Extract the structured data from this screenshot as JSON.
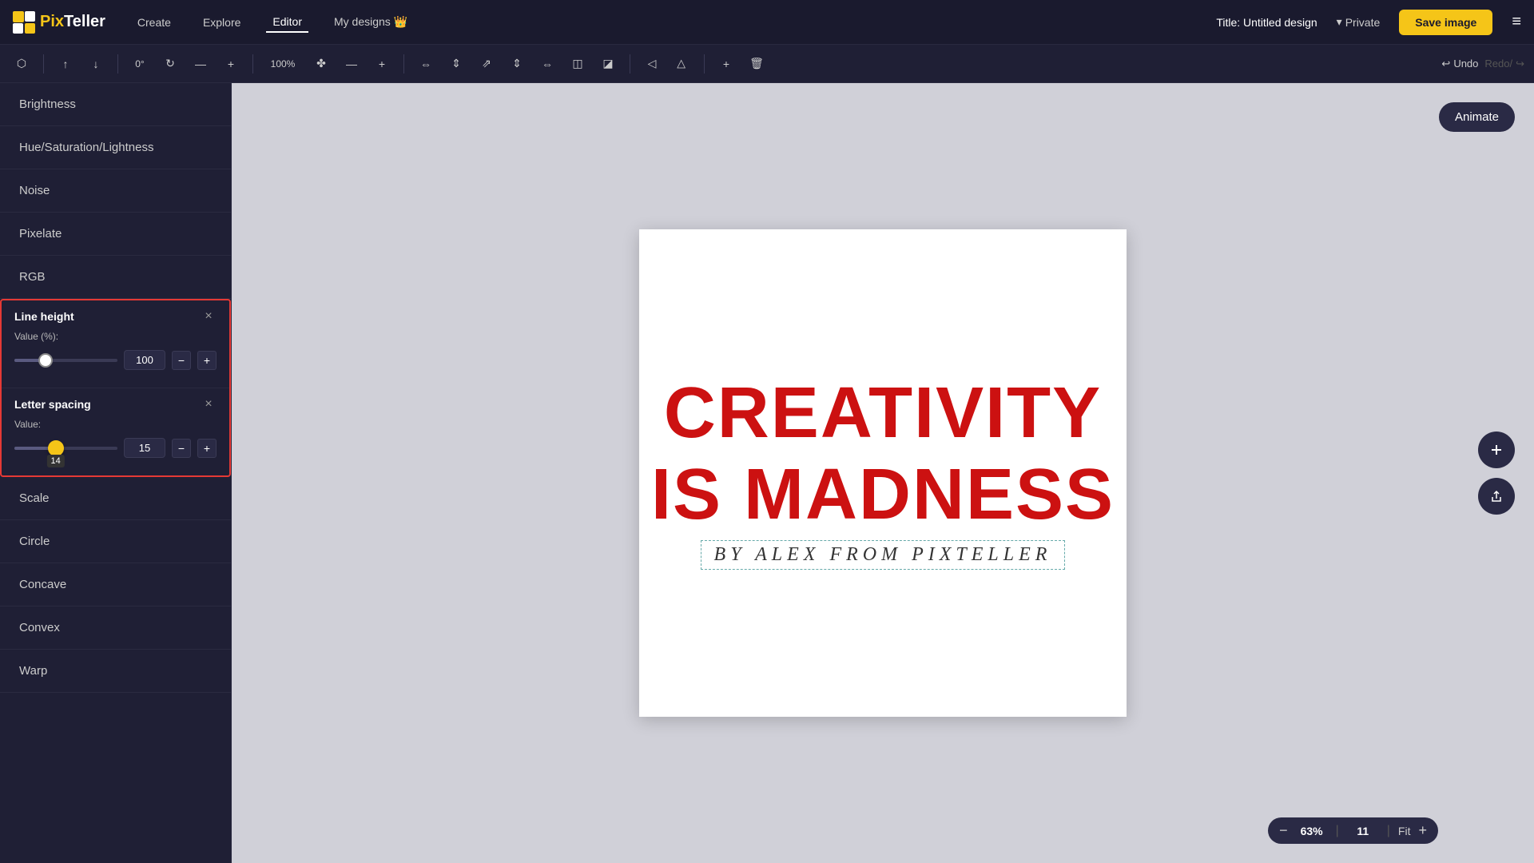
{
  "app": {
    "logo_pix": "Pix",
    "logo_teller": "Teller",
    "nav_items": [
      {
        "label": "Create",
        "id": "create"
      },
      {
        "label": "Explore",
        "id": "explore"
      },
      {
        "label": "Editor",
        "id": "editor",
        "active": true
      },
      {
        "label": "My designs",
        "id": "my-designs",
        "crown": true
      }
    ],
    "title_label": "Title:",
    "title_value": "Untitled design",
    "privacy": "Private",
    "save_label": "Save image",
    "menu_icon": "≡",
    "undo_label": "Undo",
    "redo_label": "Redo/",
    "zoom_percent": "100%"
  },
  "toolbar": {
    "icons": [
      "⬡",
      "↑⬦↓",
      "↕",
      "0°",
      "↻",
      "—",
      "+",
      "100%",
      "✤",
      "—",
      "+",
      "⇔",
      "⇕",
      "⇗",
      "⇕",
      "⇔",
      "◫",
      "◪",
      "—",
      "▤",
      "◁",
      "+",
      "✂",
      "🗑"
    ]
  },
  "sidebar": {
    "items": [
      {
        "label": "Brightness",
        "id": "brightness"
      },
      {
        "label": "Hue/Saturation/Lightness",
        "id": "hsl"
      },
      {
        "label": "Noise",
        "id": "noise"
      },
      {
        "label": "Pixelate",
        "id": "pixelate"
      },
      {
        "label": "RGB",
        "id": "rgb"
      },
      {
        "label": "Scale",
        "id": "scale"
      },
      {
        "label": "Circle",
        "id": "circle"
      },
      {
        "label": "Concave",
        "id": "concave"
      },
      {
        "label": "Convex",
        "id": "convex"
      },
      {
        "label": "Warp",
        "id": "warp"
      }
    ]
  },
  "line_height_panel": {
    "title": "Line height",
    "close_icon": "×",
    "value_label": "Value (%):",
    "value": "100",
    "slider_position_pct": 30,
    "minus_label": "−",
    "plus_label": "+"
  },
  "letter_spacing_panel": {
    "title": "Letter spacing",
    "close_icon": "×",
    "value_label": "Value:",
    "value": "15",
    "slider_position_pct": 40,
    "tooltip_value": "14",
    "minus_label": "−",
    "plus_label": "+"
  },
  "canvas": {
    "main_text_line1": "CREATIVITY",
    "main_text_line2": "IS MADNESS",
    "sub_text": "BY ALEX FROM PIXTELLER",
    "animate_label": "Animate"
  },
  "zoom_bar": {
    "minus": "−",
    "value": "63%",
    "num": "11",
    "fit": "Fit",
    "plus": "+"
  }
}
